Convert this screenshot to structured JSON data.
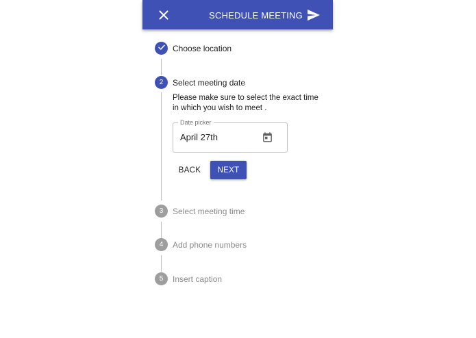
{
  "appbar": {
    "close_icon": "close-icon",
    "action_label": "SCHEDULE MEETING",
    "send_icon": "send-icon",
    "color": "#3f51b5"
  },
  "steps": [
    {
      "number": "1",
      "label": "Choose location",
      "state": "completed",
      "icon": "check-icon"
    },
    {
      "number": "2",
      "label": "Select meeting date",
      "state": "active"
    },
    {
      "number": "3",
      "label": "Select meeting time",
      "state": "inactive"
    },
    {
      "number": "4",
      "label": "Add phone numbers",
      "state": "inactive"
    },
    {
      "number": "5",
      "label": "Insert caption",
      "state": "inactive"
    }
  ],
  "active_step": {
    "description": "Please make sure to select the exact time in which you wish to meet .",
    "date_field": {
      "label": "Date picker",
      "value": "April 27th",
      "icon": "calendar-icon"
    },
    "back_label": "BACK",
    "next_label": "NEXT"
  }
}
